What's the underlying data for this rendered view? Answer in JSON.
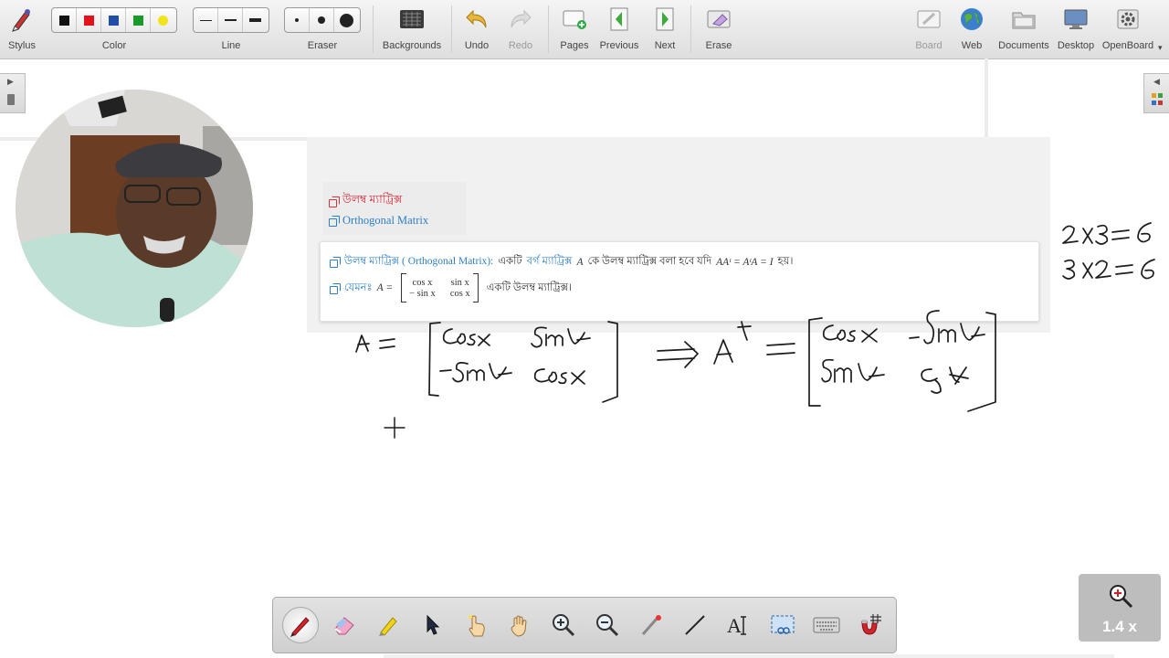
{
  "toolbar": {
    "stylus": "Stylus",
    "color": "Color",
    "line": "Line",
    "eraser": "Eraser",
    "backgrounds": "Backgrounds",
    "undo": "Undo",
    "redo": "Redo",
    "pages": "Pages",
    "previous": "Previous",
    "next": "Next",
    "erase": "Erase",
    "board": "Board",
    "web": "Web",
    "documents": "Documents",
    "desktop": "Desktop",
    "openboard": "OpenBoard"
  },
  "colors": {
    "swatches": [
      "#111111",
      "#e4121c",
      "#1f4fa6",
      "#1a9a2b",
      "#f3e31a"
    ],
    "link_blue": "#2d7fc6",
    "term_red": "#d6333f"
  },
  "document": {
    "toc_bangla": "উলম্ব ম্যাট্রিক্স",
    "toc_english": "Orthogonal Matrix",
    "def_term": "উলম্ব ম্যাট্রিক্স ( Orthogonal Matrix):",
    "def_text_1": "একটি",
    "def_term2": "বর্গ ম্যাট্রিক্স",
    "def_var": "A",
    "def_text_2": "কে উলম্ব ম্যাট্রিক্স বলা হবে যদি",
    "def_eq": "AAᵗ = AᵗA = I",
    "def_text_3": "হয়।",
    "example_label": "যেমনঃ",
    "example_var": "A =",
    "m11": "cos x",
    "m12": "sin x",
    "m21": "− sin x",
    "m22": "cos x",
    "example_text": "একটি উলম্ব ম্যাট্রিক্স।"
  },
  "zoom": {
    "level": "1.4 x"
  }
}
